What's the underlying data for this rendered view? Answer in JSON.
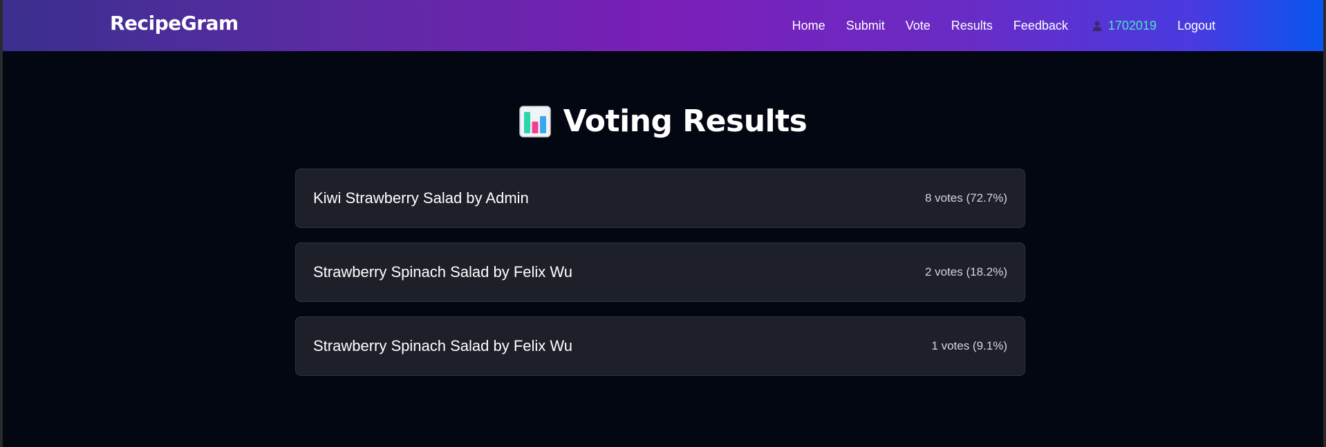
{
  "app": {
    "brand": "RecipeGram"
  },
  "nav": {
    "items": [
      {
        "label": "Home"
      },
      {
        "label": "Submit"
      },
      {
        "label": "Vote"
      },
      {
        "label": "Results"
      },
      {
        "label": "Feedback"
      }
    ],
    "user": {
      "icon": "user-icon",
      "id": "1702019",
      "id_color": "#4fe3c4"
    },
    "logout_label": "Logout"
  },
  "page": {
    "icon": "bar-chart-icon",
    "title": "Voting Results"
  },
  "results": [
    {
      "title": "Kiwi Strawberry Salad by Admin",
      "votes": "8 votes (72.7%)"
    },
    {
      "title": "Strawberry Spinach Salad by Felix Wu",
      "votes": "2 votes (18.2%)"
    },
    {
      "title": "Strawberry Spinach Salad by Felix Wu",
      "votes": "1 votes (9.1%)"
    }
  ],
  "colors": {
    "background": "#030712",
    "card": "#1d2029",
    "navbar_start": "#3b2f8f",
    "navbar_mid": "#7a1fb8",
    "navbar_end": "#0a55ee"
  }
}
